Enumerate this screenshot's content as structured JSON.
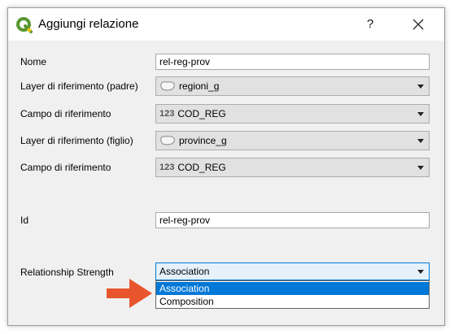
{
  "window": {
    "title": "Aggiungi relazione",
    "help_label": "?"
  },
  "form": {
    "name_label": "Nome",
    "name_value": "rel-reg-prov",
    "parent_layer_label": "Layer di riferimento (padre)",
    "parent_layer_value": "regioni_g",
    "parent_field_label": "Campo di riferimento",
    "parent_field_type": "123",
    "parent_field_value": "COD_REG",
    "child_layer_label": "Layer di riferimento (figlio)",
    "child_layer_value": "province_g",
    "child_field_label": "Campo di riferimento",
    "child_field_type": "123",
    "child_field_value": "COD_REG",
    "id_label": "Id",
    "id_value": "rel-reg-prov",
    "strength_label": "Relationship Strength",
    "strength_value": "Association",
    "strength_options": [
      "Association",
      "Composition"
    ]
  },
  "colors": {
    "accent": "#0078d7",
    "pointer_arrow": "#e8552c",
    "qgis_green": "#589632",
    "qgis_yellow": "#ee7913"
  }
}
